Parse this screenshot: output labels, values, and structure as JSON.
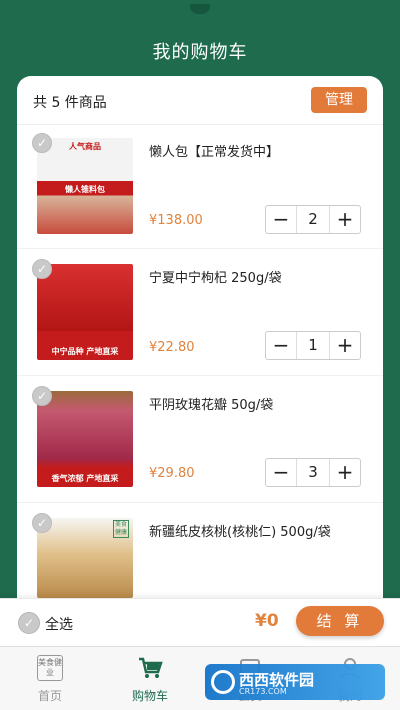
{
  "header": {
    "title": "我的购物车"
  },
  "cart": {
    "count_text": "共 5 件商品",
    "manage_label": "管理",
    "items": [
      {
        "name": "懒人包【正常发货中】",
        "price": "¥138.00",
        "qty": "2",
        "banner": "懒人锥料包",
        "top_label": "人气商品"
      },
      {
        "name": "宁夏中宁枸杞 250g/袋",
        "price": "¥22.80",
        "qty": "1",
        "banner": "中宁品种 产地直采"
      },
      {
        "name": "平阴玫瑰花瓣 50g/袋",
        "price": "¥29.80",
        "qty": "3",
        "banner": "香气浓郁 产地直采"
      },
      {
        "name": "新疆纸皮核桃(核桃仁) 500g/袋",
        "price": "",
        "qty": "",
        "badge": "美食健康"
      }
    ]
  },
  "checkout": {
    "select_all_label": "全选",
    "total": "¥0",
    "button_label": "结 算"
  },
  "tabbar": {
    "tabs": [
      {
        "label": "首页",
        "icon_text": "美食健业"
      },
      {
        "label": "购物车"
      },
      {
        "label": "会员"
      },
      {
        "label": "我的"
      }
    ]
  },
  "watermark": {
    "text": "西西软件园",
    "url": "CR173.COM"
  },
  "colors": {
    "brand_green": "#1e6b4e",
    "accent_orange": "#e27a3a",
    "price_orange": "#e0833e"
  }
}
